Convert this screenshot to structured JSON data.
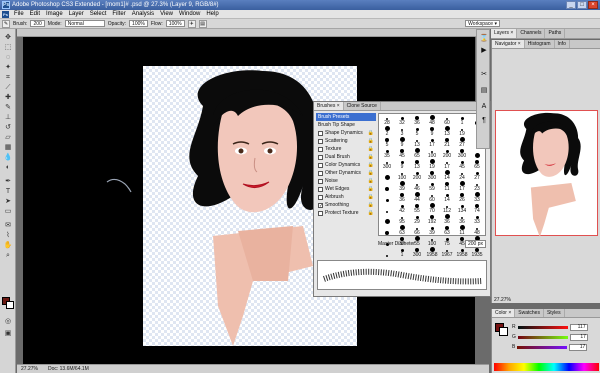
{
  "titlebar": {
    "title": "Adobe Photoshop CS3 Extended - [mom1]# .psd @ 27.3% (Layer 9, RGB/8#)"
  },
  "menu": {
    "items": [
      "File",
      "Edit",
      "Image",
      "Layer",
      "Select",
      "Filter",
      "Analysis",
      "View",
      "Window",
      "Help"
    ]
  },
  "options": {
    "brush_label": "Brush:",
    "brush_size": "200",
    "mode_label": "Mode:",
    "mode_value": "Normal",
    "opacity_label": "Opacity:",
    "opacity_value": "100%",
    "flow_label": "Flow:",
    "flow_value": "100%",
    "workspace_label": "Workspace ▾"
  },
  "document": {
    "zoom": "27.27%",
    "doc_info": "Doc: 13.6M/64.1M"
  },
  "brushes_panel": {
    "tabs": [
      "Brushes ×",
      "Clone Source"
    ],
    "list": [
      {
        "label": "Brush Presets",
        "checkbox": false,
        "selected": true,
        "lock": false
      },
      {
        "label": "Brush Tip Shape",
        "checkbox": false,
        "selected": false,
        "lock": false
      },
      {
        "label": "Shape Dynamics",
        "checkbox": true,
        "checked": false,
        "lock": true
      },
      {
        "label": "Scattering",
        "checkbox": true,
        "checked": false,
        "lock": true
      },
      {
        "label": "Texture",
        "checkbox": true,
        "checked": false,
        "lock": true
      },
      {
        "label": "Dual Brush",
        "checkbox": true,
        "checked": false,
        "lock": true
      },
      {
        "label": "Color Dynamics",
        "checkbox": true,
        "checked": false,
        "lock": true
      },
      {
        "label": "Other Dynamics",
        "checkbox": true,
        "checked": false,
        "lock": true
      },
      {
        "label": "Noise",
        "checkbox": true,
        "checked": false,
        "lock": true
      },
      {
        "label": "Wet Edges",
        "checkbox": true,
        "checked": false,
        "lock": true
      },
      {
        "label": "Airbrush",
        "checkbox": true,
        "checked": false,
        "lock": true
      },
      {
        "label": "Smoothing",
        "checkbox": true,
        "checked": true,
        "lock": true
      },
      {
        "label": "Protect Texture",
        "checkbox": true,
        "checked": false,
        "lock": true
      }
    ],
    "grid": [
      "28",
      "32",
      "36",
      "48",
      "60",
      "1",
      "",
      "2",
      "3",
      "5",
      "9",
      "13",
      "19",
      "",
      "5",
      "9",
      "13",
      "17",
      "21",
      "27",
      "",
      "35",
      "45",
      "65",
      "100",
      "200",
      "300",
      "",
      "300",
      "9",
      "13",
      "19",
      "17",
      "45",
      "65",
      "",
      "100",
      "200",
      "300",
      "14",
      "24",
      "27",
      "",
      "39",
      "46",
      "59",
      "11",
      "17",
      "23",
      "",
      "36",
      "44",
      "60",
      "14",
      "26",
      "33",
      "",
      "42",
      "55",
      "70",
      "112",
      "134",
      "74",
      "",
      "95",
      "29",
      "192",
      "36",
      "36",
      "33",
      "",
      "63",
      "66",
      "39",
      "63",
      "11",
      "48",
      "",
      "32",
      "55",
      "100",
      "75",
      "45",
      "1106",
      "",
      "1",
      "300",
      "1958",
      "1967",
      "1958",
      "1935",
      "",
      "2500",
      "",
      "",
      "",
      "",
      "",
      ""
    ],
    "master_label": "Master Diameter",
    "master_value": "200 px"
  },
  "right_dock": {
    "layers_tabs": [
      "Layers ×",
      "Channels",
      "Paths"
    ],
    "nav_tabs": [
      "Navigator ×",
      "Histogram",
      "Info"
    ],
    "nav_zoom": "27.27%",
    "color_tabs": [
      "Color ×",
      "Swatches",
      "Styles"
    ],
    "sliders": [
      {
        "label": "R",
        "value": "117"
      },
      {
        "label": "G",
        "value": "17"
      },
      {
        "label": "B",
        "value": "17"
      }
    ]
  },
  "colors": {
    "foreground": "#751111",
    "background": "#ffffff"
  }
}
